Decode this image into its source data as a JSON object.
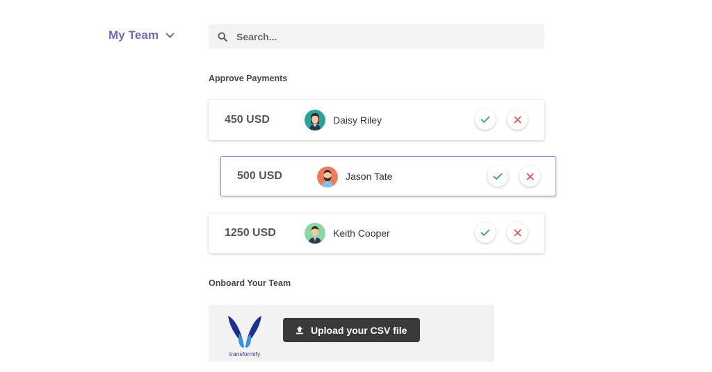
{
  "header": {
    "team_title": "My Team",
    "team_icon": "chevron-down-icon",
    "brand_color": "#6b6fb0"
  },
  "search": {
    "placeholder": "Search...",
    "value": "",
    "icon": "search-icon"
  },
  "approve_payments": {
    "title": "Approve Payments",
    "rows": [
      {
        "amount": "450 USD",
        "name": "Daisy Riley",
        "avatar": "avatar-woman",
        "selected": false
      },
      {
        "amount": "500 USD",
        "name": "Jason Tate",
        "avatar": "avatar-bearded-man",
        "selected": true
      },
      {
        "amount": "1250 USD",
        "name": "Keith Cooper",
        "avatar": "avatar-man-suit",
        "selected": false
      }
    ],
    "approve_icon": "check-icon",
    "reject_icon": "close-icon",
    "approve_color": "#3aa655",
    "reject_color": "#e05252",
    "selected_border_color": "#8b8fc9"
  },
  "onboard": {
    "title": "Onboard Your Team",
    "logo_text": "transformify",
    "upload_label": "Upload your CSV file",
    "upload_icon": "upload-icon"
  }
}
